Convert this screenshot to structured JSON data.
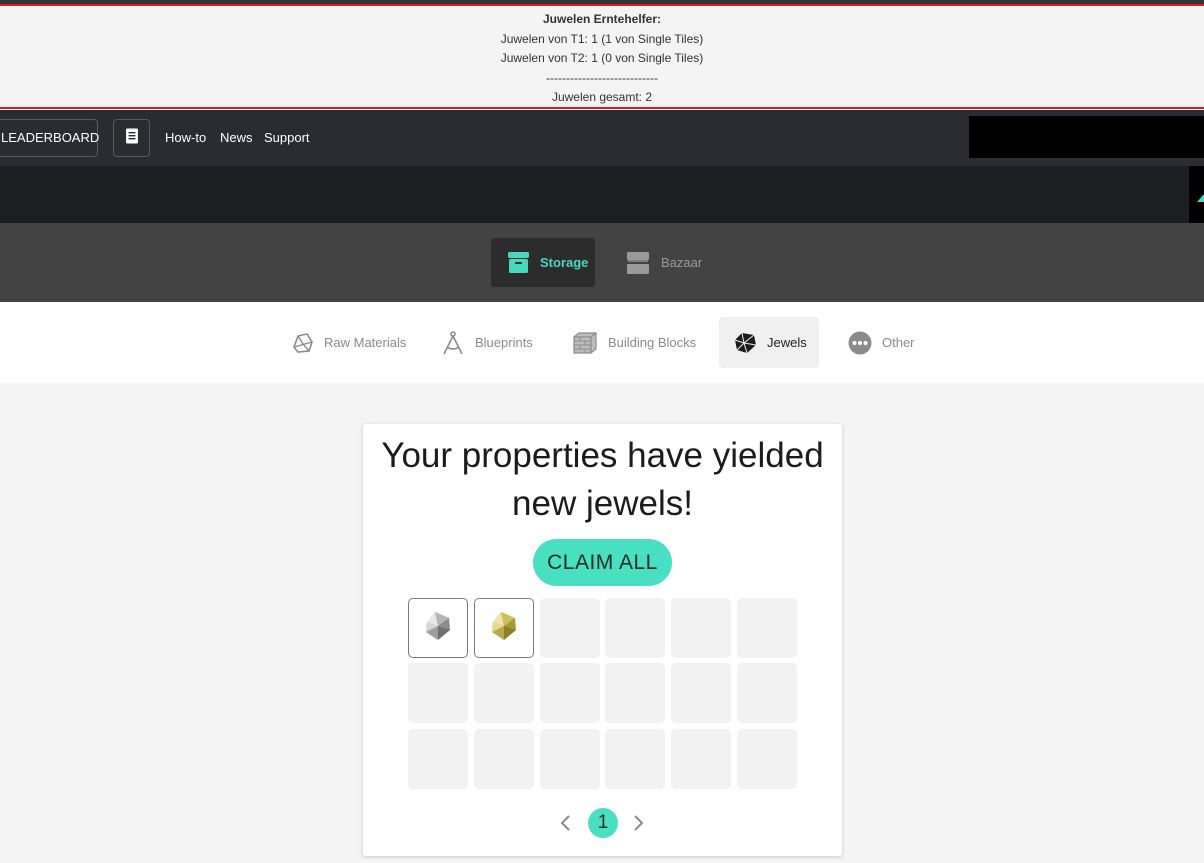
{
  "banner": {
    "title": "Juwelen Erntehelfer:",
    "line_t1": "Juwelen von T1: 1 (1 von Single Tiles)",
    "line_t2": "Juwelen von T2: 1 (0 von Single Tiles)",
    "separator": "----------------------------",
    "total": "Juwelen gesamt: 2",
    "accent_color": "#d12222"
  },
  "nav": {
    "leaderboard_label": "LEADERBOARD",
    "notes_icon": "notes-icon",
    "links": [
      "How-to",
      "News",
      "Support"
    ]
  },
  "storage_tabs": [
    {
      "label": "Storage",
      "icon": "storage-box-icon",
      "active": true
    },
    {
      "label": "Bazaar",
      "icon": "shop-icon",
      "active": false
    }
  ],
  "categories": [
    {
      "label": "Raw Materials",
      "icon": "raw-materials-icon",
      "active": false
    },
    {
      "label": "Blueprints",
      "icon": "compass-icon",
      "active": false
    },
    {
      "label": "Building Blocks",
      "icon": "brick-icon",
      "active": false
    },
    {
      "label": "Jewels",
      "icon": "jewel-icon",
      "active": true
    },
    {
      "label": "Other",
      "icon": "more-icon",
      "active": false
    }
  ],
  "card": {
    "title_line1": "Your properties have yielded",
    "title_line2": "new jewels!",
    "claim_label": "CLAIM ALL",
    "slots": [
      "silver-jewel",
      "gold-jewel",
      "",
      "",
      "",
      "",
      "",
      "",
      "",
      "",
      "",
      "",
      "",
      "",
      "",
      "",
      "",
      ""
    ],
    "current_page": "1"
  },
  "colors": {
    "accent": "#48e0c0",
    "nav_bg": "#2b2c31",
    "storage_band": "#434344"
  }
}
